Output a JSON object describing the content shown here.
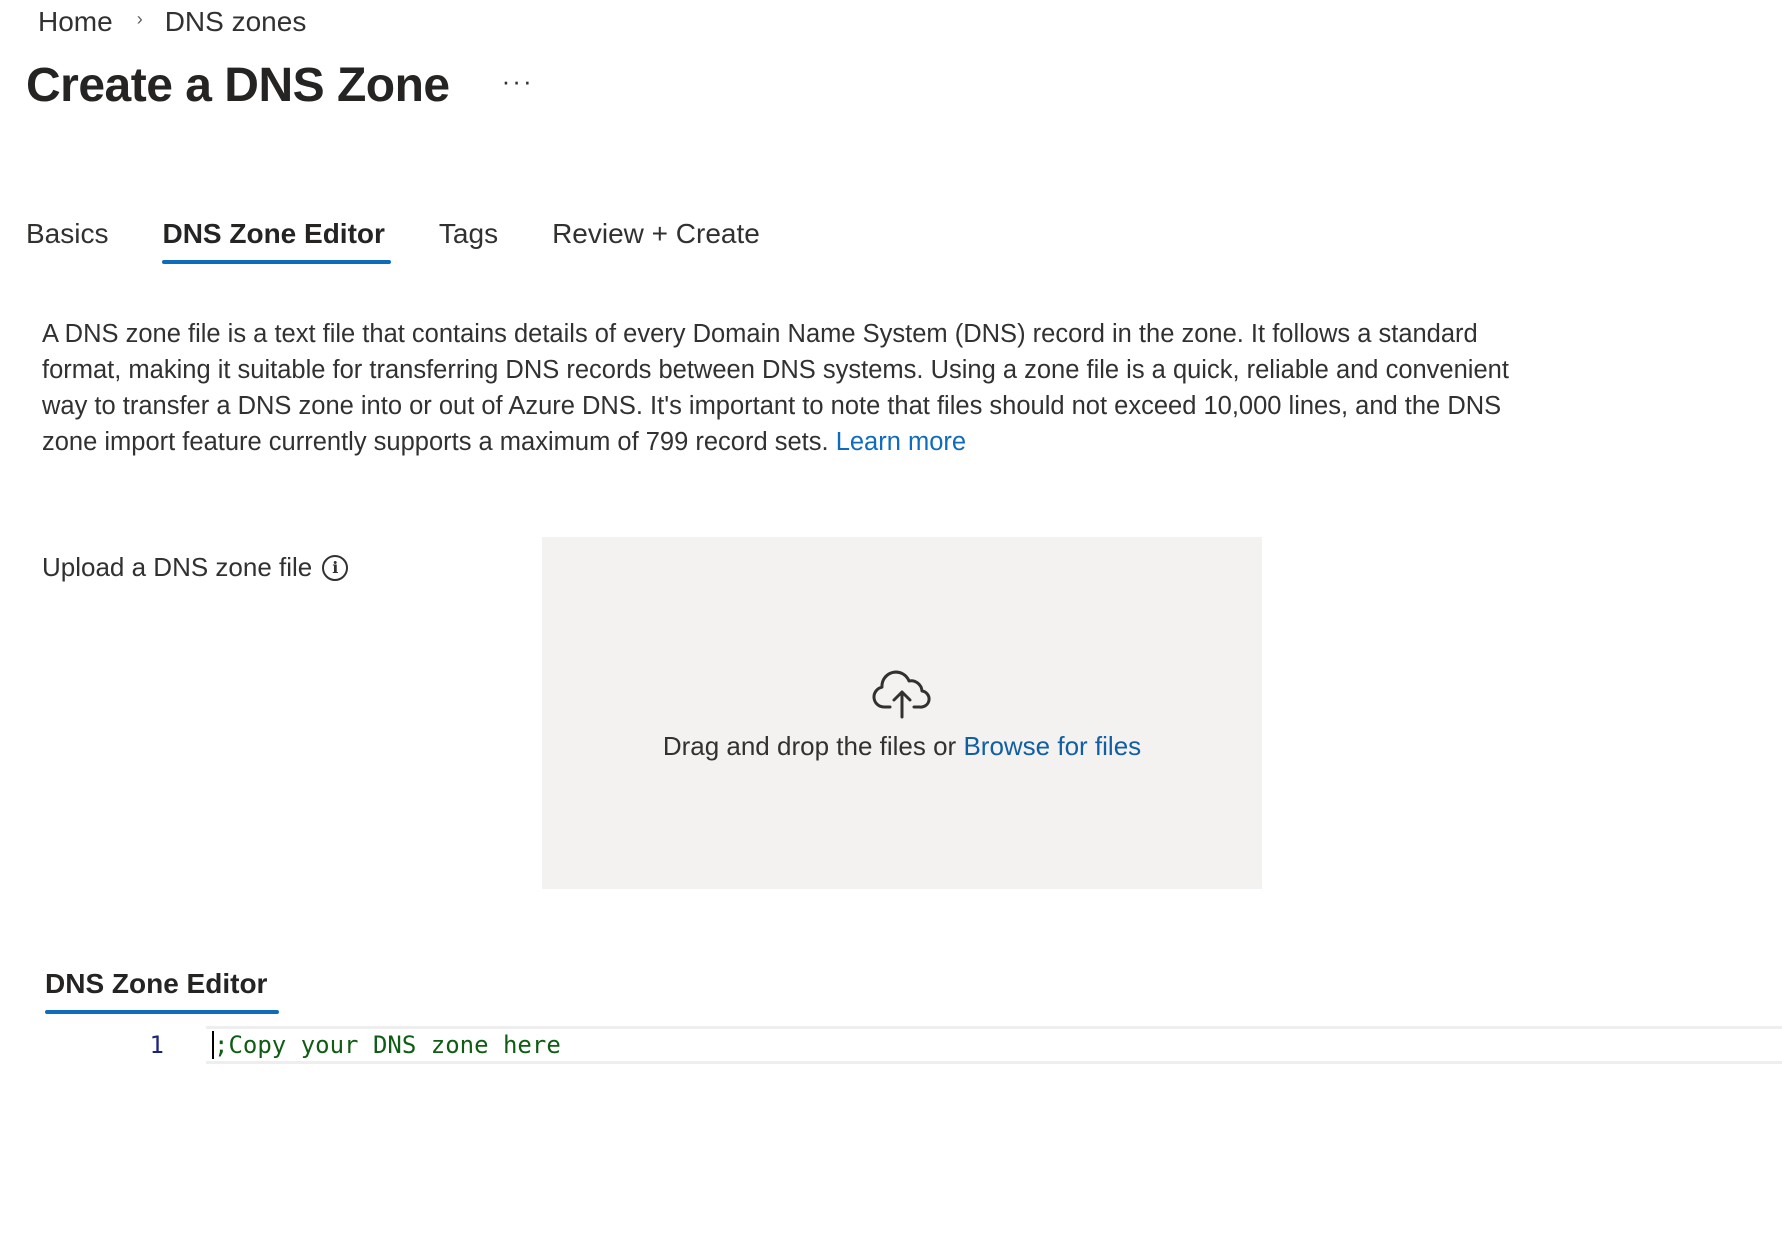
{
  "breadcrumb": {
    "home": "Home",
    "current": "DNS zones"
  },
  "header": {
    "title": "Create a DNS Zone",
    "more": "···"
  },
  "tabs": [
    {
      "label": "Basics",
      "active": false
    },
    {
      "label": "DNS Zone Editor",
      "active": true
    },
    {
      "label": "Tags",
      "active": false
    },
    {
      "label": "Review + Create",
      "active": false
    }
  ],
  "description": {
    "text": "A DNS zone file is a text file that contains details of every Domain Name System (DNS) record in the zone. It follows a standard format, making it suitable for transferring DNS records between DNS systems. Using a zone file is a quick, reliable and convenient way to transfer a DNS zone into or out of Azure DNS. It's important to note that files should not exceed 10,000 lines, and the DNS zone import feature currently supports a maximum of 799 record sets. ",
    "link": "Learn more"
  },
  "upload": {
    "label": "Upload a DNS zone file",
    "info_icon": "info-icon",
    "drop_text": "Drag and drop the files or ",
    "browse_link": "Browse for files",
    "upload_icon": "cloud-upload-icon"
  },
  "editor": {
    "heading": "DNS Zone Editor",
    "lines": [
      {
        "number": "1",
        "content": ";Copy your DNS zone here"
      }
    ]
  },
  "colors": {
    "accent": "#0f6cbd",
    "link": "#0f6cbd",
    "dropzone_bg": "#f3f2f1",
    "comment": "#0f5c14"
  }
}
